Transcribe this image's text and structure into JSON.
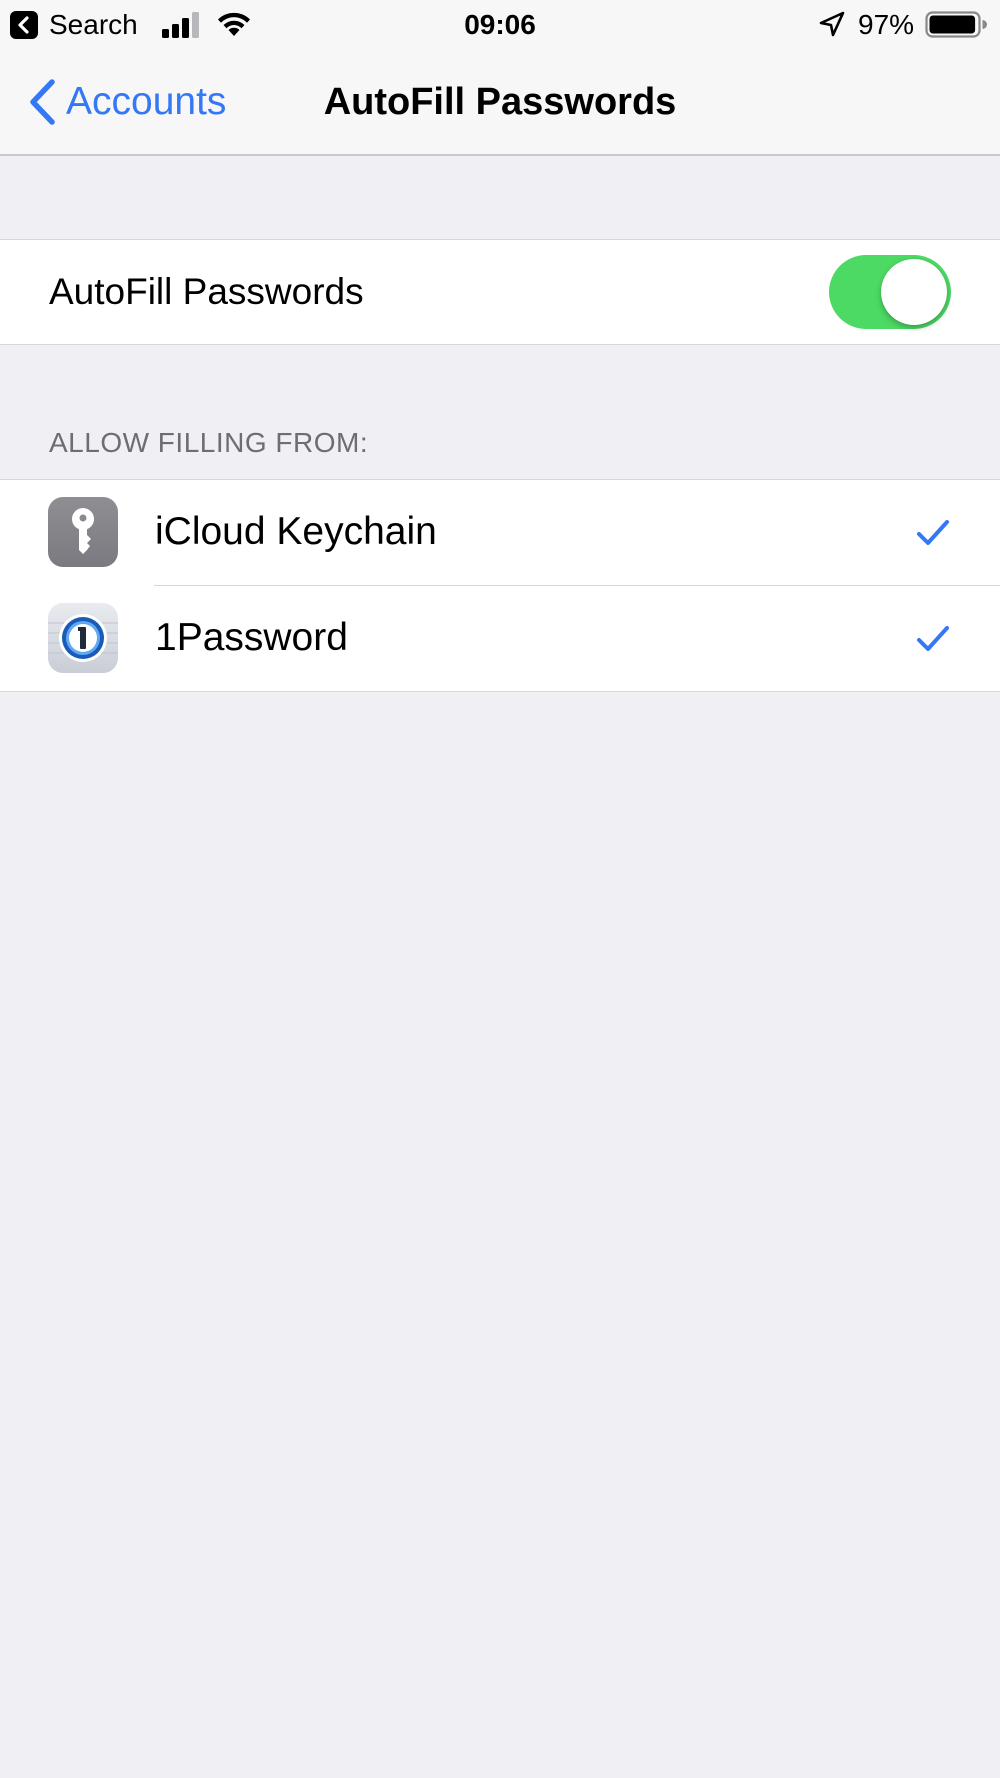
{
  "status_bar": {
    "back_app": "Search",
    "time": "09:06",
    "battery_percent": "97%",
    "battery_level": 0.97,
    "signal_bars_active": 3,
    "signal_bars_total": 4,
    "icons": [
      "back-app-icon",
      "signal-icon",
      "wifi-icon",
      "location-icon",
      "battery-icon"
    ]
  },
  "nav": {
    "back_label": "Accounts",
    "title": "AutoFill Passwords",
    "accent_color": "#3478F6"
  },
  "autofill": {
    "label": "AutoFill Passwords",
    "enabled": true,
    "switch_on_color": "#4CD964"
  },
  "section": {
    "header": "ALLOW FILLING FROM:"
  },
  "providers": [
    {
      "label": "iCloud Keychain",
      "icon": "key-icon",
      "checked": true
    },
    {
      "label": "1Password",
      "icon": "1password-icon",
      "checked": true
    }
  ]
}
